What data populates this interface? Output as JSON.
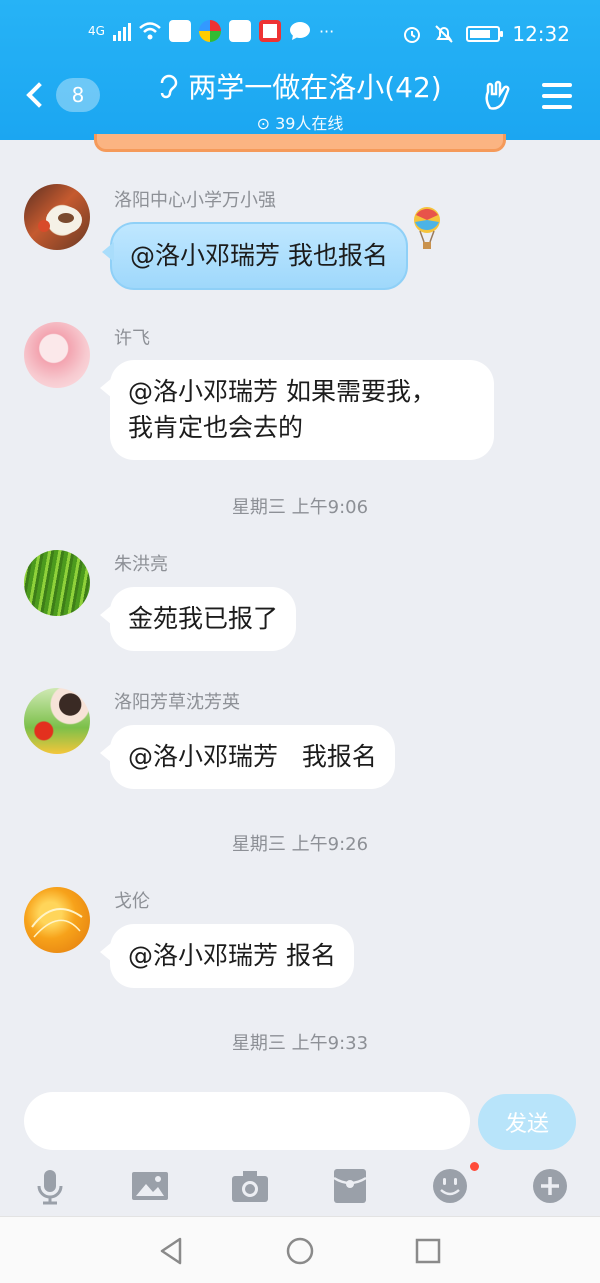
{
  "status_bar": {
    "network": "4G",
    "time": "12:32",
    "more": "···",
    "battery_level": 0.75
  },
  "header": {
    "back_badge": "8",
    "title": "两学一做在洛小(42)",
    "online": "39人在线"
  },
  "messages": [
    {
      "sender": "洛阳中心小学万小强",
      "text": "@洛小邓瑞芳 我也报名"
    },
    {
      "sender": "许飞",
      "line1": "@洛小邓瑞芳 如果需要我，",
      "line2": "我肯定也会去的"
    },
    {
      "sender": "朱洪亮",
      "text": "金苑我已报了"
    },
    {
      "sender": "洛阳芳草沈芳英",
      "text": "@洛小邓瑞芳   我报名"
    },
    {
      "sender": "戈伦",
      "text": "@洛小邓瑞芳 报名"
    }
  ],
  "timestamps": [
    "星期三 上午9:06",
    "星期三 上午9:26",
    "星期三 上午9:33"
  ],
  "input": {
    "value": "",
    "send_label": "发送"
  },
  "colors": {
    "accent": "#1ba6f1",
    "background": "#eceef3",
    "notification_dot": "#ff4b3a"
  }
}
